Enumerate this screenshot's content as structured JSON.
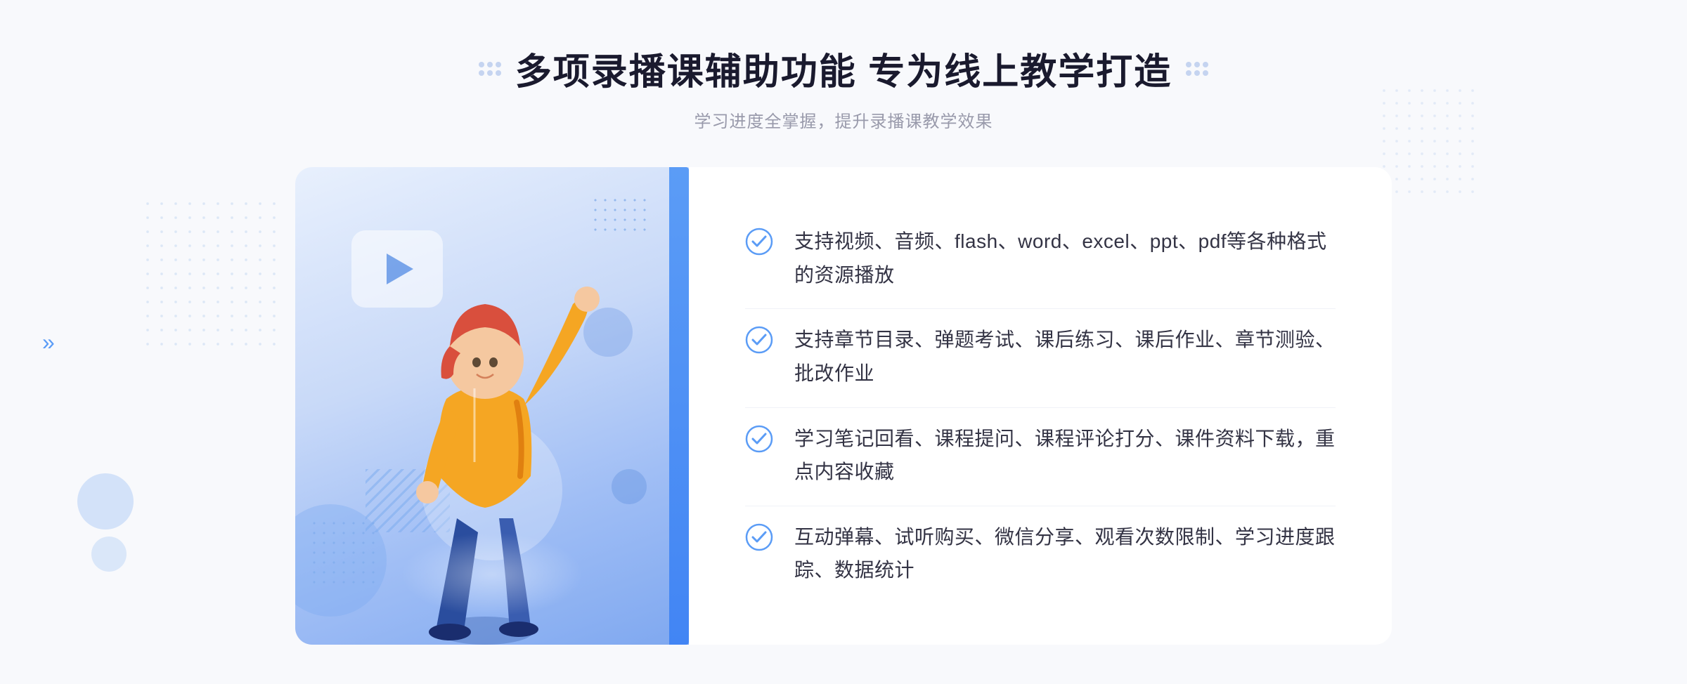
{
  "header": {
    "title": "多项录播课辅助功能 专为线上教学打造",
    "subtitle": "学习进度全掌握，提升录播课教学效果"
  },
  "features": [
    {
      "id": 1,
      "text": "支持视频、音频、flash、word、excel、ppt、pdf等各种格式的资源播放"
    },
    {
      "id": 2,
      "text": "支持章节目录、弹题考试、课后练习、课后作业、章节测验、批改作业"
    },
    {
      "id": 3,
      "text": "学习笔记回看、课程提问、课程评论打分、课件资料下载，重点内容收藏"
    },
    {
      "id": 4,
      "text": "互动弹幕、试听购买、微信分享、观看次数限制、学习进度跟踪、数据统计"
    }
  ],
  "decorators": {
    "left_chevron": "»",
    "play_icon": "▶"
  },
  "colors": {
    "primary_blue": "#4285f4",
    "light_blue": "#7aabf0",
    "title_color": "#1a1a2e",
    "subtitle_color": "#999aab",
    "text_color": "#333344",
    "check_color": "#5b9cf6"
  }
}
